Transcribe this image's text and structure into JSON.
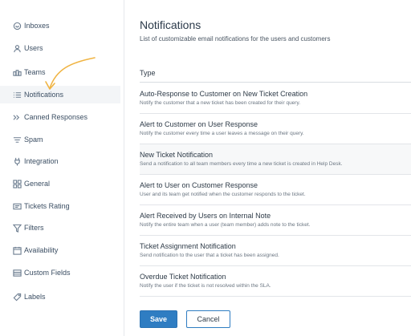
{
  "sidebar": {
    "items": [
      {
        "label": "Inboxes",
        "icon": "inbox-icon"
      },
      {
        "label": "Users",
        "icon": "user-icon"
      },
      {
        "label": "Teams",
        "icon": "team-icon"
      },
      {
        "label": "Notifications",
        "icon": "list-icon",
        "active": true
      },
      {
        "label": "Canned Responses",
        "icon": "chat-icon"
      },
      {
        "label": "Spam",
        "icon": "filter-lines-icon"
      },
      {
        "label": "Integration",
        "icon": "plug-icon"
      },
      {
        "label": "General",
        "icon": "grid-icon"
      },
      {
        "label": "Tickets Rating",
        "icon": "rating-icon"
      },
      {
        "label": "Filters",
        "icon": "funnel-icon"
      },
      {
        "label": "Availability",
        "icon": "calendar-icon"
      },
      {
        "label": "Custom Fields",
        "icon": "fields-icon"
      },
      {
        "label": "Labels",
        "icon": "tag-icon"
      }
    ]
  },
  "main": {
    "title": "Notifications",
    "subtitle": "List of customizable email notifications for the users and customers",
    "type_header": "Type",
    "notifications": [
      {
        "title": "Auto-Response to Customer on New Ticket Creation",
        "desc": "Notify the customer that a new ticket has been created for their query."
      },
      {
        "title": "Alert to Customer on User Response",
        "desc": "Notify the customer every time a user leaves a message on their query."
      },
      {
        "title": "New Ticket Notification",
        "desc": "Send a notification to all team members every time a new ticket is created in Help Desk."
      },
      {
        "title": "Alert to User on Customer Response",
        "desc": "User and its team get notified when the customer responds to the ticket."
      },
      {
        "title": "Alert Received by Users on Internal Note",
        "desc": "Notify the entire team when a user (team member) adds note to the ticket."
      },
      {
        "title": "Ticket Assignment Notification",
        "desc": "Send notification to the user that a ticket has been assigned."
      },
      {
        "title": "Overdue Ticket Notification",
        "desc": "Notify the user if the ticket is not resolved within the SLA."
      }
    ],
    "save_label": "Save",
    "cancel_label": "Cancel"
  },
  "colors": {
    "accent": "#2f7dc2",
    "arrow": "#f0b443",
    "active_bg": "#f3f5f7"
  }
}
